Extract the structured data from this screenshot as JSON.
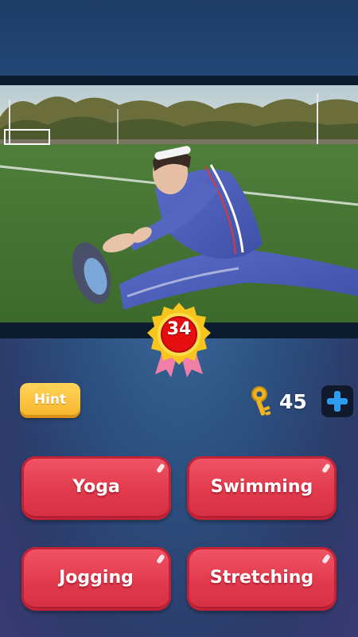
{
  "level": {
    "number": "34"
  },
  "hint": {
    "label": "Hint"
  },
  "keys": {
    "count": "45"
  },
  "answers": [
    {
      "label": "Yoga"
    },
    {
      "label": "Swimming"
    },
    {
      "label": "Jogging"
    },
    {
      "label": "Stretching"
    }
  ],
  "colors": {
    "answer_red": "#e23a4d",
    "hint_yellow": "#f6b528",
    "badge_gold": "#f7c51e",
    "plus_blue": "#2e9cf0"
  },
  "icons": [
    "key-icon",
    "plus-icon",
    "level-badge-icon"
  ]
}
